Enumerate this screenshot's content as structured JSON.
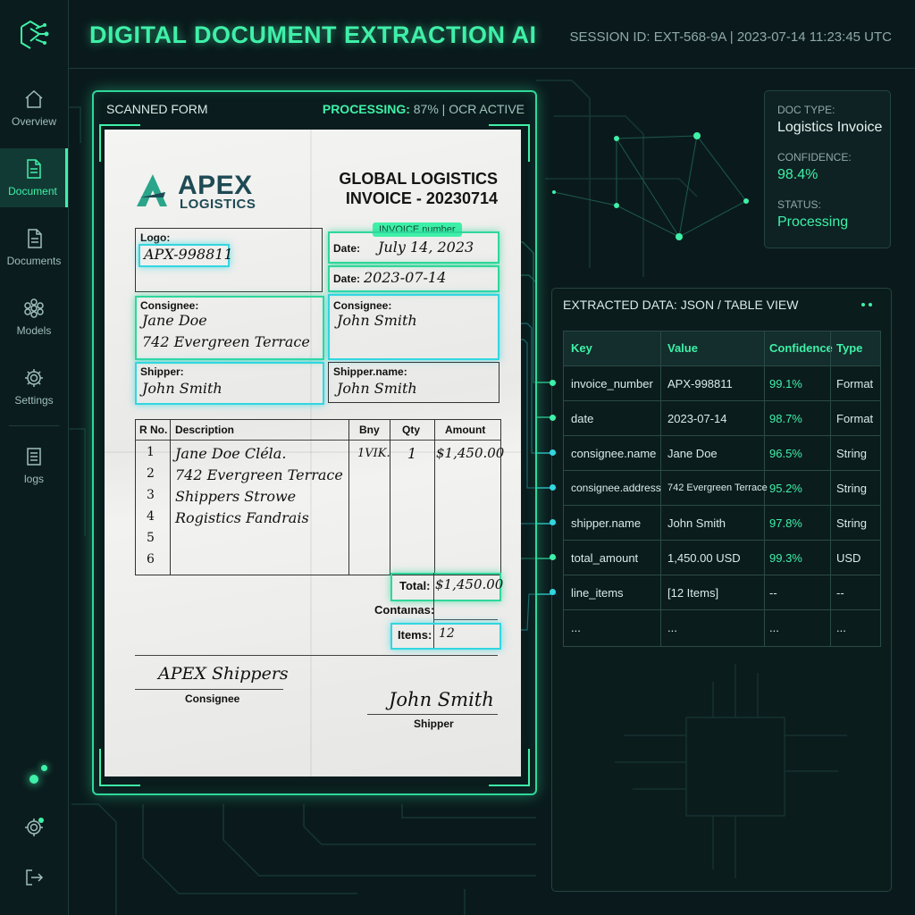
{
  "header": {
    "title": "DIGITAL DOCUMENT EXTRACTION AI",
    "session": "SESSION ID: EXT-568-9A | 2023-07-14 11:23:45 UTC"
  },
  "sidebar": {
    "items": [
      {
        "label": "Overview",
        "icon": "home-icon"
      },
      {
        "label": "Document",
        "icon": "document-icon",
        "active": true
      },
      {
        "label": "Documents",
        "icon": "documents-icon"
      },
      {
        "label": "Models",
        "icon": "models-icon"
      },
      {
        "label": "Settings",
        "icon": "gear-icon"
      },
      {
        "label": "logs",
        "icon": "logs-icon"
      }
    ],
    "bottom_icons": [
      "gear-icon",
      "logout-icon"
    ]
  },
  "scan": {
    "label": "SCANNED FORM",
    "status_key": "PROCESSING:",
    "status_rest": "87% | OCR ACTIVE"
  },
  "invoice": {
    "brand_name": "APEX",
    "brand_sub": "LOGISTICS",
    "head_line1": "GLOBAL LOGISTICS",
    "head_line2": "INVOICE - 20230714",
    "logo_label": "Logo:",
    "logo_value": "APX-998811",
    "invoice_tag": "INVOICE number",
    "date_label": "Date:",
    "date1_value": "July 14, 2023",
    "date2_label": "Date:",
    "date2_value": "2023-07-14",
    "consignee_label": "Consignee:",
    "consignee_name": "Jane Doe",
    "consignee_address": "742 Evergreen Terrace",
    "consignee2_label": "Consignee:",
    "consignee2_name": "John Smith",
    "shipper_label": "Shipper:",
    "shipper_value": "John Smith",
    "shipper2_label": "Shipper.name:",
    "shipper2_value": "John Smith",
    "table_headers": [
      "R No.",
      "Description",
      "Bny",
      "Qty",
      "Amount"
    ],
    "rows": [
      {
        "no": "1",
        "desc": "Jane Doe Cléla.",
        "bny": "1VIK.",
        "qty": "1",
        "amount": "$1,450.00"
      },
      {
        "no": "2",
        "desc": "742 Evergreen Terrace",
        "bny": "",
        "qty": "",
        "amount": ""
      },
      {
        "no": "3",
        "desc": "Shippers Strowe",
        "bny": "",
        "qty": "",
        "amount": ""
      },
      {
        "no": "4",
        "desc": "Rogistics Fandrais",
        "bny": "",
        "qty": "",
        "amount": ""
      },
      {
        "no": "5",
        "desc": "",
        "bny": "",
        "qty": "",
        "amount": ""
      },
      {
        "no": "6",
        "desc": "",
        "bny": "",
        "qty": "",
        "amount": ""
      }
    ],
    "total_label": "Total:",
    "total_value": "$1,450.00",
    "contains_label": "Contaınas:",
    "items_label": "Items:",
    "items_value": "12",
    "sig1_value": "APEX Shippers",
    "sig1_label": "Consignee",
    "sig2_value": "John Smith",
    "sig2_label": "Shipper"
  },
  "doc_card": {
    "type_label": "DOC TYPE:",
    "type_value": "Logistics Invoice",
    "conf_label": "CONFIDENCE:",
    "conf_value": "98.4%",
    "status_label": "STATUS:",
    "status_value": "Processing"
  },
  "extracted": {
    "title": "EXTRACTED DATA: JSON / TABLE VIEW",
    "headers": [
      "Key",
      "Value",
      "Confidence",
      "Type"
    ],
    "rows": [
      {
        "key": "invoice_number",
        "value": "APX-998811",
        "confidence": "99.1%",
        "type": "Format"
      },
      {
        "key": "date",
        "value": "2023-07-14",
        "confidence": "98.7%",
        "type": "Format"
      },
      {
        "key": "consignee.name",
        "value": "Jane Doe",
        "confidence": "96.5%",
        "type": "String"
      },
      {
        "key": "consignee.address",
        "value": "742 Evergreen Terrace",
        "confidence": "95.2%",
        "type": "String"
      },
      {
        "key": "shipper.name",
        "value": "John Smith",
        "confidence": "97.8%",
        "type": "String"
      },
      {
        "key": "total_amount",
        "value": "1,450.00 USD",
        "confidence": "99.3%",
        "type": "USD"
      },
      {
        "key": "line_items",
        "value": "[12 Items]",
        "confidence": "--",
        "type": "--"
      },
      {
        "key": "...",
        "value": "...",
        "confidence": "...",
        "type": "..."
      }
    ]
  },
  "colors": {
    "accent": "#3ff0a8",
    "cyan": "#32d6e0",
    "background": "#0a1a1c"
  }
}
